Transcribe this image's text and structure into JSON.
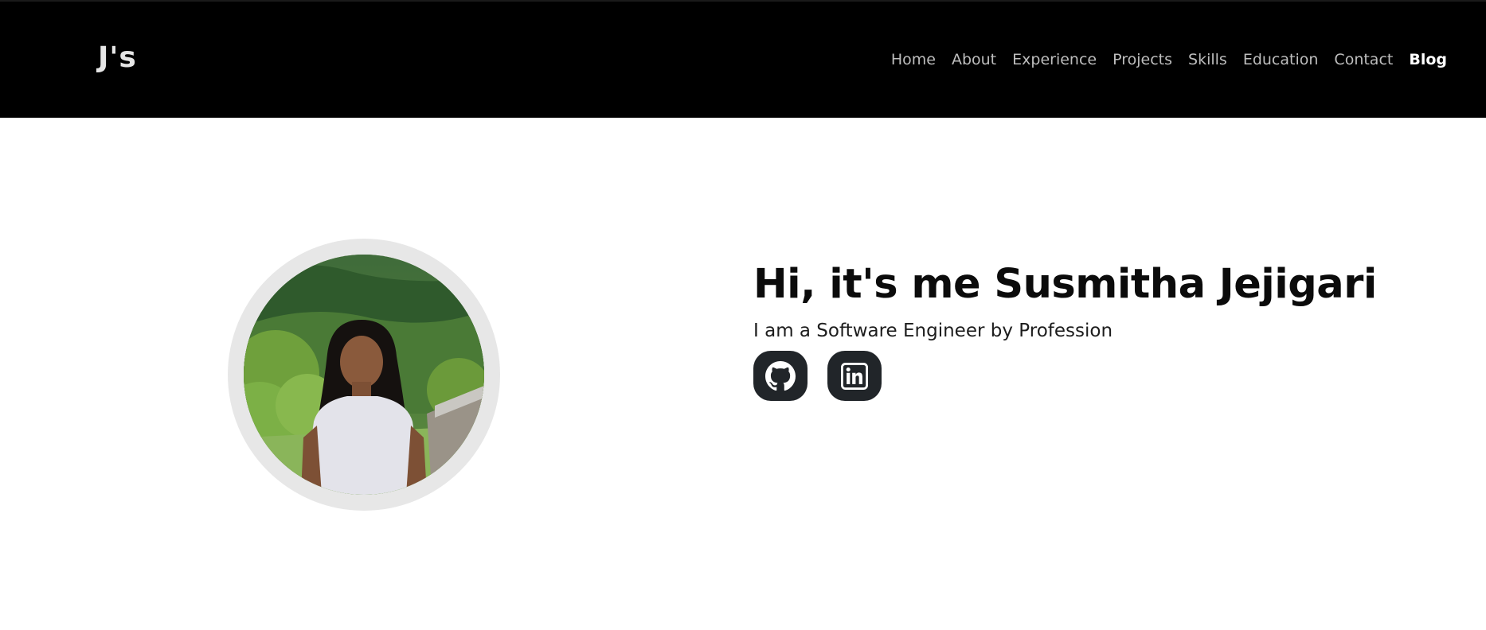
{
  "navbar": {
    "brand": "J's",
    "links": [
      {
        "label": "Home"
      },
      {
        "label": "About"
      },
      {
        "label": "Experience"
      },
      {
        "label": "Projects"
      },
      {
        "label": "Skills"
      },
      {
        "label": "Education"
      },
      {
        "label": "Contact"
      },
      {
        "label": "Blog",
        "active": true
      }
    ]
  },
  "hero": {
    "headline": "Hi, it's me Susmitha Jejigari",
    "tagline": "I am a Software Engineer by Profession",
    "avatar_icon": "profile-photo",
    "socials": [
      {
        "icon": "github-icon"
      },
      {
        "icon": "linkedin-icon"
      }
    ]
  },
  "colors": {
    "navbar_bg": "#000000",
    "nav_link": "#bdbdbd",
    "nav_link_active": "#ffffff",
    "social_bg": "#212529",
    "avatar_ring": "#e7e7e7"
  }
}
